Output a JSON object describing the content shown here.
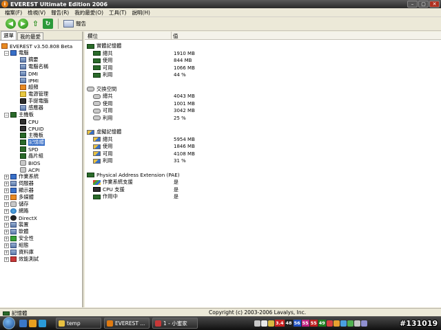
{
  "window": {
    "title": "EVEREST Ultimate Edition 2006",
    "title_icon": "i",
    "controls": {
      "minimize": "–",
      "maximize": "▢",
      "close": "✕"
    }
  },
  "menu": [
    "檔案(F)",
    "檢視(V)",
    "報告(R)",
    "我的最愛(O)",
    "工具(T)",
    "說明(H)"
  ],
  "toolbar": {
    "report_label": "報告"
  },
  "left_tabs": [
    "選單",
    "我的最愛"
  ],
  "tree": [
    {
      "label": "EVEREST v3.50.808 Beta",
      "icon": "ic-orange",
      "level": 0,
      "exp": ""
    },
    {
      "label": "電腦",
      "icon": "ic-blue",
      "level": 1,
      "exp": "−"
    },
    {
      "label": "摘要",
      "icon": "ic-box",
      "level": 2,
      "exp": ""
    },
    {
      "label": "電腦名稱",
      "icon": "ic-box",
      "level": 2,
      "exp": ""
    },
    {
      "label": "DMI",
      "icon": "ic-box",
      "level": 2,
      "exp": ""
    },
    {
      "label": "IPMI",
      "icon": "ic-box",
      "level": 2,
      "exp": ""
    },
    {
      "label": "超頻",
      "icon": "ic-orange",
      "level": 2,
      "exp": ""
    },
    {
      "label": "電源管理",
      "icon": "ic-yellow",
      "level": 2,
      "exp": ""
    },
    {
      "label": "手提電腦",
      "icon": "ic-cpu",
      "level": 2,
      "exp": ""
    },
    {
      "label": "感應器",
      "icon": "ic-box",
      "level": 2,
      "exp": ""
    },
    {
      "label": "主機板",
      "icon": "ic-chip",
      "level": 1,
      "exp": "−"
    },
    {
      "label": "CPU",
      "icon": "ic-cpu",
      "level": 2,
      "exp": ""
    },
    {
      "label": "CPUID",
      "icon": "ic-cpu",
      "level": 2,
      "exp": ""
    },
    {
      "label": "主機板",
      "icon": "ic-chip",
      "level": 2,
      "exp": ""
    },
    {
      "label": "記憶體",
      "icon": "ic-chip",
      "level": 2,
      "exp": "",
      "selected": true
    },
    {
      "label": "SPD",
      "icon": "ic-chip",
      "level": 2,
      "exp": ""
    },
    {
      "label": "晶片組",
      "icon": "ic-chip",
      "level": 2,
      "exp": ""
    },
    {
      "label": "BIOS",
      "icon": "ic-disk",
      "level": 2,
      "exp": ""
    },
    {
      "label": "ACPI",
      "icon": "ic-disk",
      "level": 2,
      "exp": ""
    },
    {
      "label": "作業系統",
      "icon": "ic-blue",
      "level": 1,
      "exp": "+"
    },
    {
      "label": "伺服器",
      "icon": "ic-box",
      "level": 1,
      "exp": "+"
    },
    {
      "label": "顯示器",
      "icon": "ic-blue",
      "level": 1,
      "exp": "+"
    },
    {
      "label": "多媒體",
      "icon": "ic-orange",
      "level": 1,
      "exp": "+"
    },
    {
      "label": "儲存",
      "icon": "ic-disk",
      "level": 1,
      "exp": "+"
    },
    {
      "label": "網路",
      "icon": "ic-globe",
      "level": 1,
      "exp": "+"
    },
    {
      "label": "DirectX",
      "icon": "ic-x",
      "level": 1,
      "exp": "+"
    },
    {
      "label": "裝置",
      "icon": "ic-box",
      "level": 1,
      "exp": "+"
    },
    {
      "label": "軟體",
      "icon": "ic-box",
      "level": 1,
      "exp": "+"
    },
    {
      "label": "安全性",
      "icon": "ic-green",
      "level": 1,
      "exp": "+"
    },
    {
      "label": "組態",
      "icon": "ic-box",
      "level": 1,
      "exp": "+"
    },
    {
      "label": "資料庫",
      "icon": "ic-box",
      "level": 1,
      "exp": "+"
    },
    {
      "label": "效能測試",
      "icon": "ic-red",
      "level": 1,
      "exp": "+"
    }
  ],
  "columns": {
    "field": "欄位",
    "value": "值"
  },
  "sections": [
    {
      "title": "實體記憶體",
      "icon": "mem",
      "rows": [
        {
          "label": "總共",
          "value": "1910 MB",
          "icon": "mem"
        },
        {
          "label": "使用",
          "value": "844 MB",
          "icon": "mem"
        },
        {
          "label": "可用",
          "value": "1066 MB",
          "icon": "mem"
        },
        {
          "label": "利用",
          "value": "44 %",
          "icon": "mem"
        }
      ]
    },
    {
      "title": "交換空間",
      "icon": "swap",
      "rows": [
        {
          "label": "總共",
          "value": "4043 MB",
          "icon": "swap"
        },
        {
          "label": "使用",
          "value": "1001 MB",
          "icon": "swap"
        },
        {
          "label": "可用",
          "value": "3042 MB",
          "icon": "swap"
        },
        {
          "label": "利用",
          "value": "25 %",
          "icon": "swap"
        }
      ]
    },
    {
      "title": "虛擬記憶體",
      "icon": "virt",
      "rows": [
        {
          "label": "總共",
          "value": "5954 MB",
          "icon": "virt"
        },
        {
          "label": "使用",
          "value": "1846 MB",
          "icon": "virt"
        },
        {
          "label": "可用",
          "value": "4108 MB",
          "icon": "virt"
        },
        {
          "label": "利用",
          "value": "31 %",
          "icon": "virt"
        }
      ]
    },
    {
      "title": "Physical Address Extension (PAE)",
      "icon": "pae",
      "rows": [
        {
          "label": "作業系統支援",
          "value": "是",
          "icon": "os"
        },
        {
          "label": "CPU 支援",
          "value": "是",
          "icon": "cpu"
        },
        {
          "label": "作用中",
          "value": "是",
          "icon": "pae"
        }
      ]
    }
  ],
  "status": {
    "left": "記憶體",
    "center": "Copyright (c) 2003-2006 Lavalys, Inc."
  },
  "taskbar": {
    "tasks": [
      {
        "label": "temp",
        "color": "#e8c040"
      },
      {
        "label": "EVEREST ...",
        "color": "#e07a10"
      },
      {
        "label": "1 - 小蜜家",
        "color": "#c83838"
      }
    ],
    "tray_badges": [
      {
        "text": "3.4",
        "bg": "#c82020"
      },
      {
        "text": "48",
        "bg": "#202020"
      },
      {
        "text": "56",
        "bg": "#2050c0"
      },
      {
        "text": "55",
        "bg": "#c02080"
      },
      {
        "text": "55",
        "bg": "#c02020"
      },
      {
        "text": "49",
        "bg": "#208020"
      }
    ]
  },
  "watermark": "#131019"
}
